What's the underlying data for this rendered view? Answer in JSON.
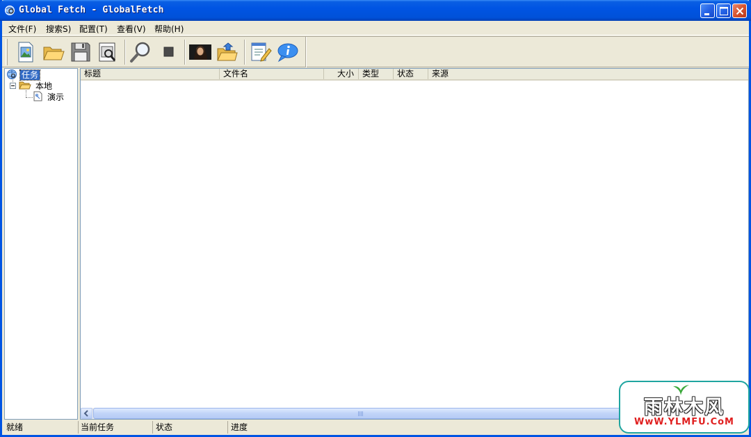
{
  "window": {
    "title": "Global Fetch - GlobalFetch"
  },
  "menubar": {
    "items": [
      {
        "label": "文件(F)"
      },
      {
        "label": "搜索S)"
      },
      {
        "label": "配置(T)"
      },
      {
        "label": "查看(V)"
      },
      {
        "label": "帮助(H)"
      }
    ]
  },
  "toolbar": {
    "icons": [
      "new-image-icon",
      "open-folder-icon",
      "save-disk-icon",
      "print-preview-icon",
      "search-magnifier-icon",
      "stop-icon",
      "photo-thumbnail-icon",
      "open-folder-arrow-icon",
      "edit-document-icon",
      "info-bubble-icon"
    ]
  },
  "tree": {
    "root": {
      "label": "任务"
    },
    "children": [
      {
        "label": "本地",
        "children": [
          {
            "label": "演示"
          }
        ]
      }
    ]
  },
  "list": {
    "columns": [
      {
        "label": "标题"
      },
      {
        "label": "文件名"
      },
      {
        "label": "大小"
      },
      {
        "label": "类型"
      },
      {
        "label": "状态"
      },
      {
        "label": "来源"
      }
    ],
    "rows": []
  },
  "statusbar": {
    "cells": [
      {
        "label": "就绪"
      },
      {
        "label": "当前任务"
      },
      {
        "label": "状态"
      },
      {
        "label": "进度"
      }
    ]
  },
  "watermark": {
    "text": "雨林木风",
    "url": "WwW.YLMFU.CoM"
  },
  "colors": {
    "titlebar": "#0054e3",
    "face": "#ece9d8",
    "selection": "#316ac5",
    "watermark_border": "#1fa5a0",
    "watermark_url": "#e02020"
  }
}
